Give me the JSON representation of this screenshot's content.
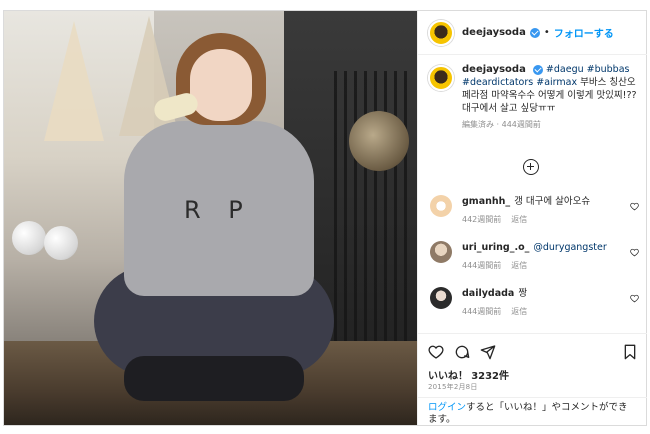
{
  "post": {
    "username": "deejaysoda",
    "follow_label": "フォローする",
    "separator": "•",
    "caption_parts": {
      "tags1": "#daegu #bubbas #deardictators #airmax",
      "text": " 부바스 칭산오페라점 마약옥수수 어떻게 이렇게 맛있찌!??대구에서 살고 싶당ㅠㅠ"
    },
    "caption_meta": "編集済み · 444週間前"
  },
  "comments": [
    {
      "user": "gmanhh_",
      "text": "갱 대구에 살아오슈",
      "time": "442週間前",
      "reply": "返信",
      "avatar_color": "#f3d2a9"
    },
    {
      "user": "uri_uring_.o_",
      "text": "@durygangster",
      "time": "444週間前",
      "reply": "返信",
      "avatar_color": "#c9b49a"
    },
    {
      "user": "dailydada",
      "text": "짱",
      "time": "444週間前",
      "reply": "返信",
      "avatar_color": "#2b2b2b"
    }
  ],
  "likes": {
    "label": "いいね！",
    "count": "3232件"
  },
  "date": "2015年2月8日",
  "login_prompt": {
    "link": "ログイン",
    "text": "すると「いいね！」やコメントができます。"
  },
  "colors": {
    "accent": "#0095f6",
    "verified": "#3897f0",
    "avatar_yellow": "#f6c400"
  },
  "icons": {
    "verified": "verified-badge-icon",
    "add_comment": "plus-circle-icon",
    "heart": "heart-icon",
    "comment": "comment-icon",
    "share": "share-icon",
    "save": "bookmark-icon"
  }
}
